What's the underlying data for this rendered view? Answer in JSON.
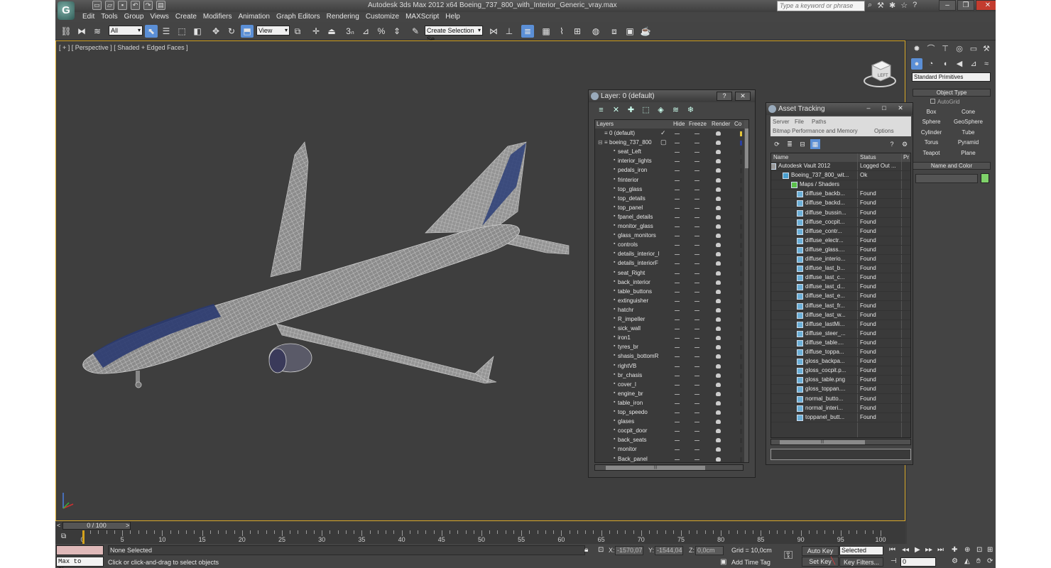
{
  "window": {
    "title": "Autodesk 3ds Max  2012 x64      Boeing_737_800_with_Interior_Generic_vray.max",
    "search_placeholder": "Type a keyword or phrase"
  },
  "menu": [
    "Edit",
    "Tools",
    "Group",
    "Views",
    "Create",
    "Modifiers",
    "Animation",
    "Graph Editors",
    "Rendering",
    "Customize",
    "MAXScript",
    "Help"
  ],
  "toolbar": {
    "selection_filter": "All",
    "coord_system": "View",
    "named_selection": "Create Selection Se"
  },
  "viewport": {
    "label": "[ + ] [ Perspective ] [ Shaded + Edged Faces ]",
    "viewcube_label": "LEFT"
  },
  "timeline": {
    "position": "0 / 100",
    "ticks": [
      0,
      5,
      10,
      15,
      20,
      25,
      30,
      35,
      40,
      45,
      50,
      55,
      60,
      65,
      70,
      75,
      80,
      85,
      90,
      95,
      100
    ]
  },
  "status": {
    "selection": "None Selected",
    "prompt": "Click or click-and-drag to select objects",
    "maxscript_text": "Max to Physc",
    "x_label": "X:",
    "x_value": "-1570,079",
    "y_label": "Y:",
    "y_value": "-1544,048",
    "z_label": "Z:",
    "z_value": "0,0cm",
    "grid": "Grid = 10,0cm",
    "add_time_tag": "Add Time Tag",
    "auto_key": "Auto Key",
    "set_key": "Set Key",
    "selected_dd": "Selected",
    "key_filters": "Key Filters...",
    "frame": "0"
  },
  "command_panel": {
    "category": "Standard Primitives",
    "object_type_title": "Object Type",
    "autogrid": "AutoGrid",
    "primitives": [
      "Box",
      "Cone",
      "Sphere",
      "GeoSphere",
      "Cylinder",
      "Tube",
      "Torus",
      "Pyramid",
      "Teapot",
      "Plane"
    ],
    "name_color_title": "Name and Color"
  },
  "layer_dialog": {
    "title": "Layer: 0 (default)",
    "help_btn": "?",
    "close_btn": "✕",
    "columns": [
      "Layers",
      "Hide",
      "Freeze",
      "Render",
      "Co"
    ],
    "rows": [
      {
        "name": "0 (default)",
        "level": 0,
        "mark": "check"
      },
      {
        "name": "boeing_737_800",
        "level": 0,
        "mark": "box"
      },
      {
        "name": "seat_Left",
        "level": 1
      },
      {
        "name": "interior_lights",
        "level": 1
      },
      {
        "name": "pedals_iron",
        "level": 1
      },
      {
        "name": "frinterior",
        "level": 1
      },
      {
        "name": "top_glass",
        "level": 1
      },
      {
        "name": "top_details",
        "level": 1
      },
      {
        "name": "top_panel",
        "level": 1
      },
      {
        "name": "fpanel_details",
        "level": 1
      },
      {
        "name": "monitor_glass",
        "level": 1
      },
      {
        "name": "glass_monitors",
        "level": 1
      },
      {
        "name": "controls",
        "level": 1
      },
      {
        "name": "details_interior_l",
        "level": 1
      },
      {
        "name": "details_interiorF",
        "level": 1
      },
      {
        "name": "seat_Right",
        "level": 1
      },
      {
        "name": "back_interior",
        "level": 1
      },
      {
        "name": "table_buttons",
        "level": 1
      },
      {
        "name": "extinguisher",
        "level": 1
      },
      {
        "name": "hatchr",
        "level": 1
      },
      {
        "name": "R_impeller",
        "level": 1
      },
      {
        "name": "sick_wall",
        "level": 1
      },
      {
        "name": "iron1",
        "level": 1
      },
      {
        "name": "tyres_br",
        "level": 1
      },
      {
        "name": "shasis_bottomR",
        "level": 1
      },
      {
        "name": "rightVB",
        "level": 1
      },
      {
        "name": "br_chasis",
        "level": 1
      },
      {
        "name": "cover_l",
        "level": 1
      },
      {
        "name": "engine_br",
        "level": 1
      },
      {
        "name": "table_iron",
        "level": 1
      },
      {
        "name": "top_speedo",
        "level": 1
      },
      {
        "name": "glases",
        "level": 1
      },
      {
        "name": "cocpit_door",
        "level": 1
      },
      {
        "name": "back_seats",
        "level": 1
      },
      {
        "name": "monitor",
        "level": 1
      },
      {
        "name": "Back_panel",
        "level": 1
      }
    ]
  },
  "asset_dialog": {
    "title": "Asset Tracking",
    "menus": [
      "Server",
      "File",
      "Paths",
      "Bitmap Performance and Memory",
      "Options"
    ],
    "columns": [
      "Name",
      "Status",
      "Pr"
    ],
    "rows": [
      {
        "name": "Autodesk Vault 2012",
        "status": "Logged Out ...",
        "level": 0
      },
      {
        "name": "Boeing_737_800_wit...",
        "status": "Ok",
        "level": 1
      },
      {
        "name": "Maps / Shaders",
        "status": "",
        "level": 2
      },
      {
        "name": "diffuse_backb...",
        "status": "Found",
        "level": 3
      },
      {
        "name": "diffuse_backd...",
        "status": "Found",
        "level": 3
      },
      {
        "name": "diffuse_bussin...",
        "status": "Found",
        "level": 3
      },
      {
        "name": "diffuse_cocpit...",
        "status": "Found",
        "level": 3
      },
      {
        "name": "diffuse_contr...",
        "status": "Found",
        "level": 3
      },
      {
        "name": "diffuse_electr...",
        "status": "Found",
        "level": 3
      },
      {
        "name": "diffuse_glass....",
        "status": "Found",
        "level": 3
      },
      {
        "name": "diffuse_interio...",
        "status": "Found",
        "level": 3
      },
      {
        "name": "diffuse_last_b...",
        "status": "Found",
        "level": 3
      },
      {
        "name": "diffuse_last_c...",
        "status": "Found",
        "level": 3
      },
      {
        "name": "diffuse_last_d...",
        "status": "Found",
        "level": 3
      },
      {
        "name": "diffuse_last_e...",
        "status": "Found",
        "level": 3
      },
      {
        "name": "diffuse_last_fr...",
        "status": "Found",
        "level": 3
      },
      {
        "name": "diffuse_last_w...",
        "status": "Found",
        "level": 3
      },
      {
        "name": "diffuse_lastMi...",
        "status": "Found",
        "level": 3
      },
      {
        "name": "diffuse_steer_...",
        "status": "Found",
        "level": 3
      },
      {
        "name": "diffuse_table....",
        "status": "Found",
        "level": 3
      },
      {
        "name": "diffuse_toppa...",
        "status": "Found",
        "level": 3
      },
      {
        "name": "gloss_backpa...",
        "status": "Found",
        "level": 3
      },
      {
        "name": "gloss_cocpit.p...",
        "status": "Found",
        "level": 3
      },
      {
        "name": "gloss_table.png",
        "status": "Found",
        "level": 3
      },
      {
        "name": "gloss_toppan....",
        "status": "Found",
        "level": 3
      },
      {
        "name": "normal_butto...",
        "status": "Found",
        "level": 3
      },
      {
        "name": "normal_interi...",
        "status": "Found",
        "level": 3
      },
      {
        "name": "toppanel_butt...",
        "status": "Found",
        "level": 3
      }
    ]
  },
  "colors": {
    "viewport_border": "#d9a92a",
    "accent": "#5b8fd6",
    "close": "#c33c2e"
  }
}
